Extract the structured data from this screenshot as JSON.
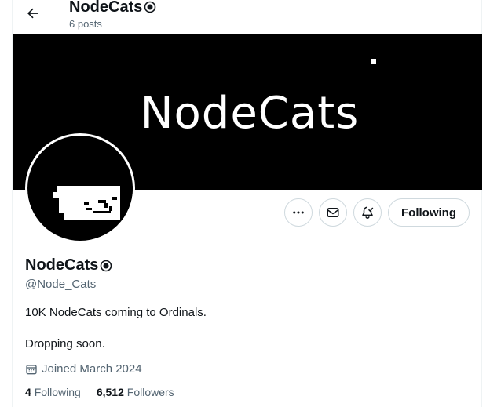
{
  "header": {
    "title": "NodeCats",
    "post_count": "6 posts",
    "back_icon": "arrow-left-icon"
  },
  "banner": {
    "text": "NodeCats"
  },
  "actions": {
    "more_icon": "more-icon",
    "message_icon": "mail-icon",
    "notify_icon": "bell-check-icon",
    "following_label": "Following"
  },
  "profile": {
    "name": "NodeCats",
    "handle": "@Node_Cats",
    "bio_line1": "10K NodeCats coming to Ordinals.",
    "bio_line2": "Dropping soon.",
    "joined": "Joined March 2024",
    "following_count": "4",
    "following_label": "Following",
    "followers_count": "6,512",
    "followers_label": "Followers"
  },
  "colors": {
    "text": "#0f1419",
    "muted": "#536471",
    "border": "#cfd9de",
    "banner": "#000000"
  }
}
